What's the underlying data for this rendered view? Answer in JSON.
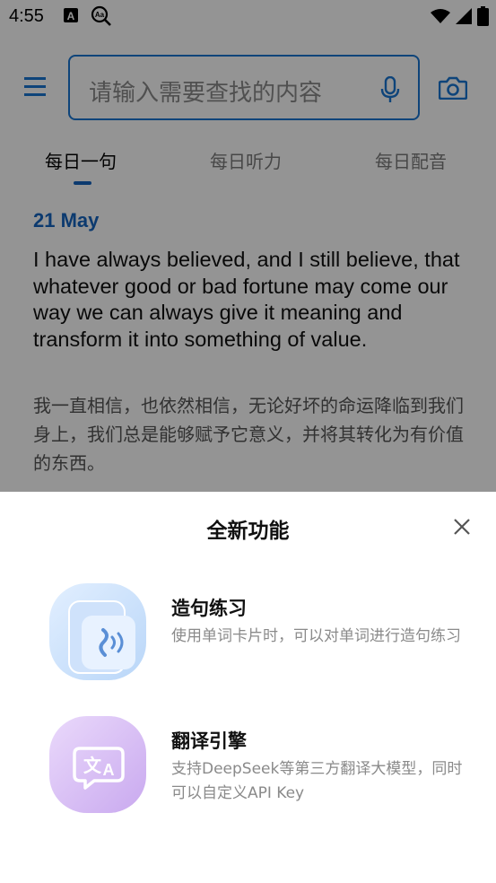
{
  "status_bar": {
    "time": "4:55",
    "icons": [
      "font-a-icon",
      "dictionary-search-icon",
      "wifi-icon",
      "signal-icon",
      "battery-icon"
    ]
  },
  "header": {
    "search_placeholder": "请输入需要查找的内容",
    "menu_icon": "menu-icon",
    "mic_icon": "mic-icon",
    "camera_icon": "camera-icon"
  },
  "tabs": [
    {
      "label": "每日一句",
      "active": true
    },
    {
      "label": "每日听力",
      "active": false
    },
    {
      "label": "每日配音",
      "active": false
    }
  ],
  "daily": {
    "date": "21 May",
    "quote_en": "I have always believed, and I still believe, that whatever good or bad fortune may come our way we can always give it meaning and transform it into something of value.",
    "quote_zh": "我一直相信，也依然相信，无论好坏的命运降临到我们身上，我们总是能够赋予它意义，并将其转化为有价值的东西。"
  },
  "sheet": {
    "title": "全新功能",
    "close_icon": "close-icon",
    "features": [
      {
        "name": "造句练习",
        "desc": "使用单词卡片时，可以对单词进行造句练习",
        "icon": "speech-practice-icon"
      },
      {
        "name": "翻译引擎",
        "desc": "支持DeepSeek等第三方翻译大模型，同时可以自定义API Key",
        "icon": "translate-icon"
      }
    ]
  },
  "colors": {
    "accent": "#1565c0",
    "scrim": "rgba(0,0,0,0.42)",
    "feature1_bg": "#cfe3fb",
    "feature2_bg": "#dcc8f5"
  }
}
